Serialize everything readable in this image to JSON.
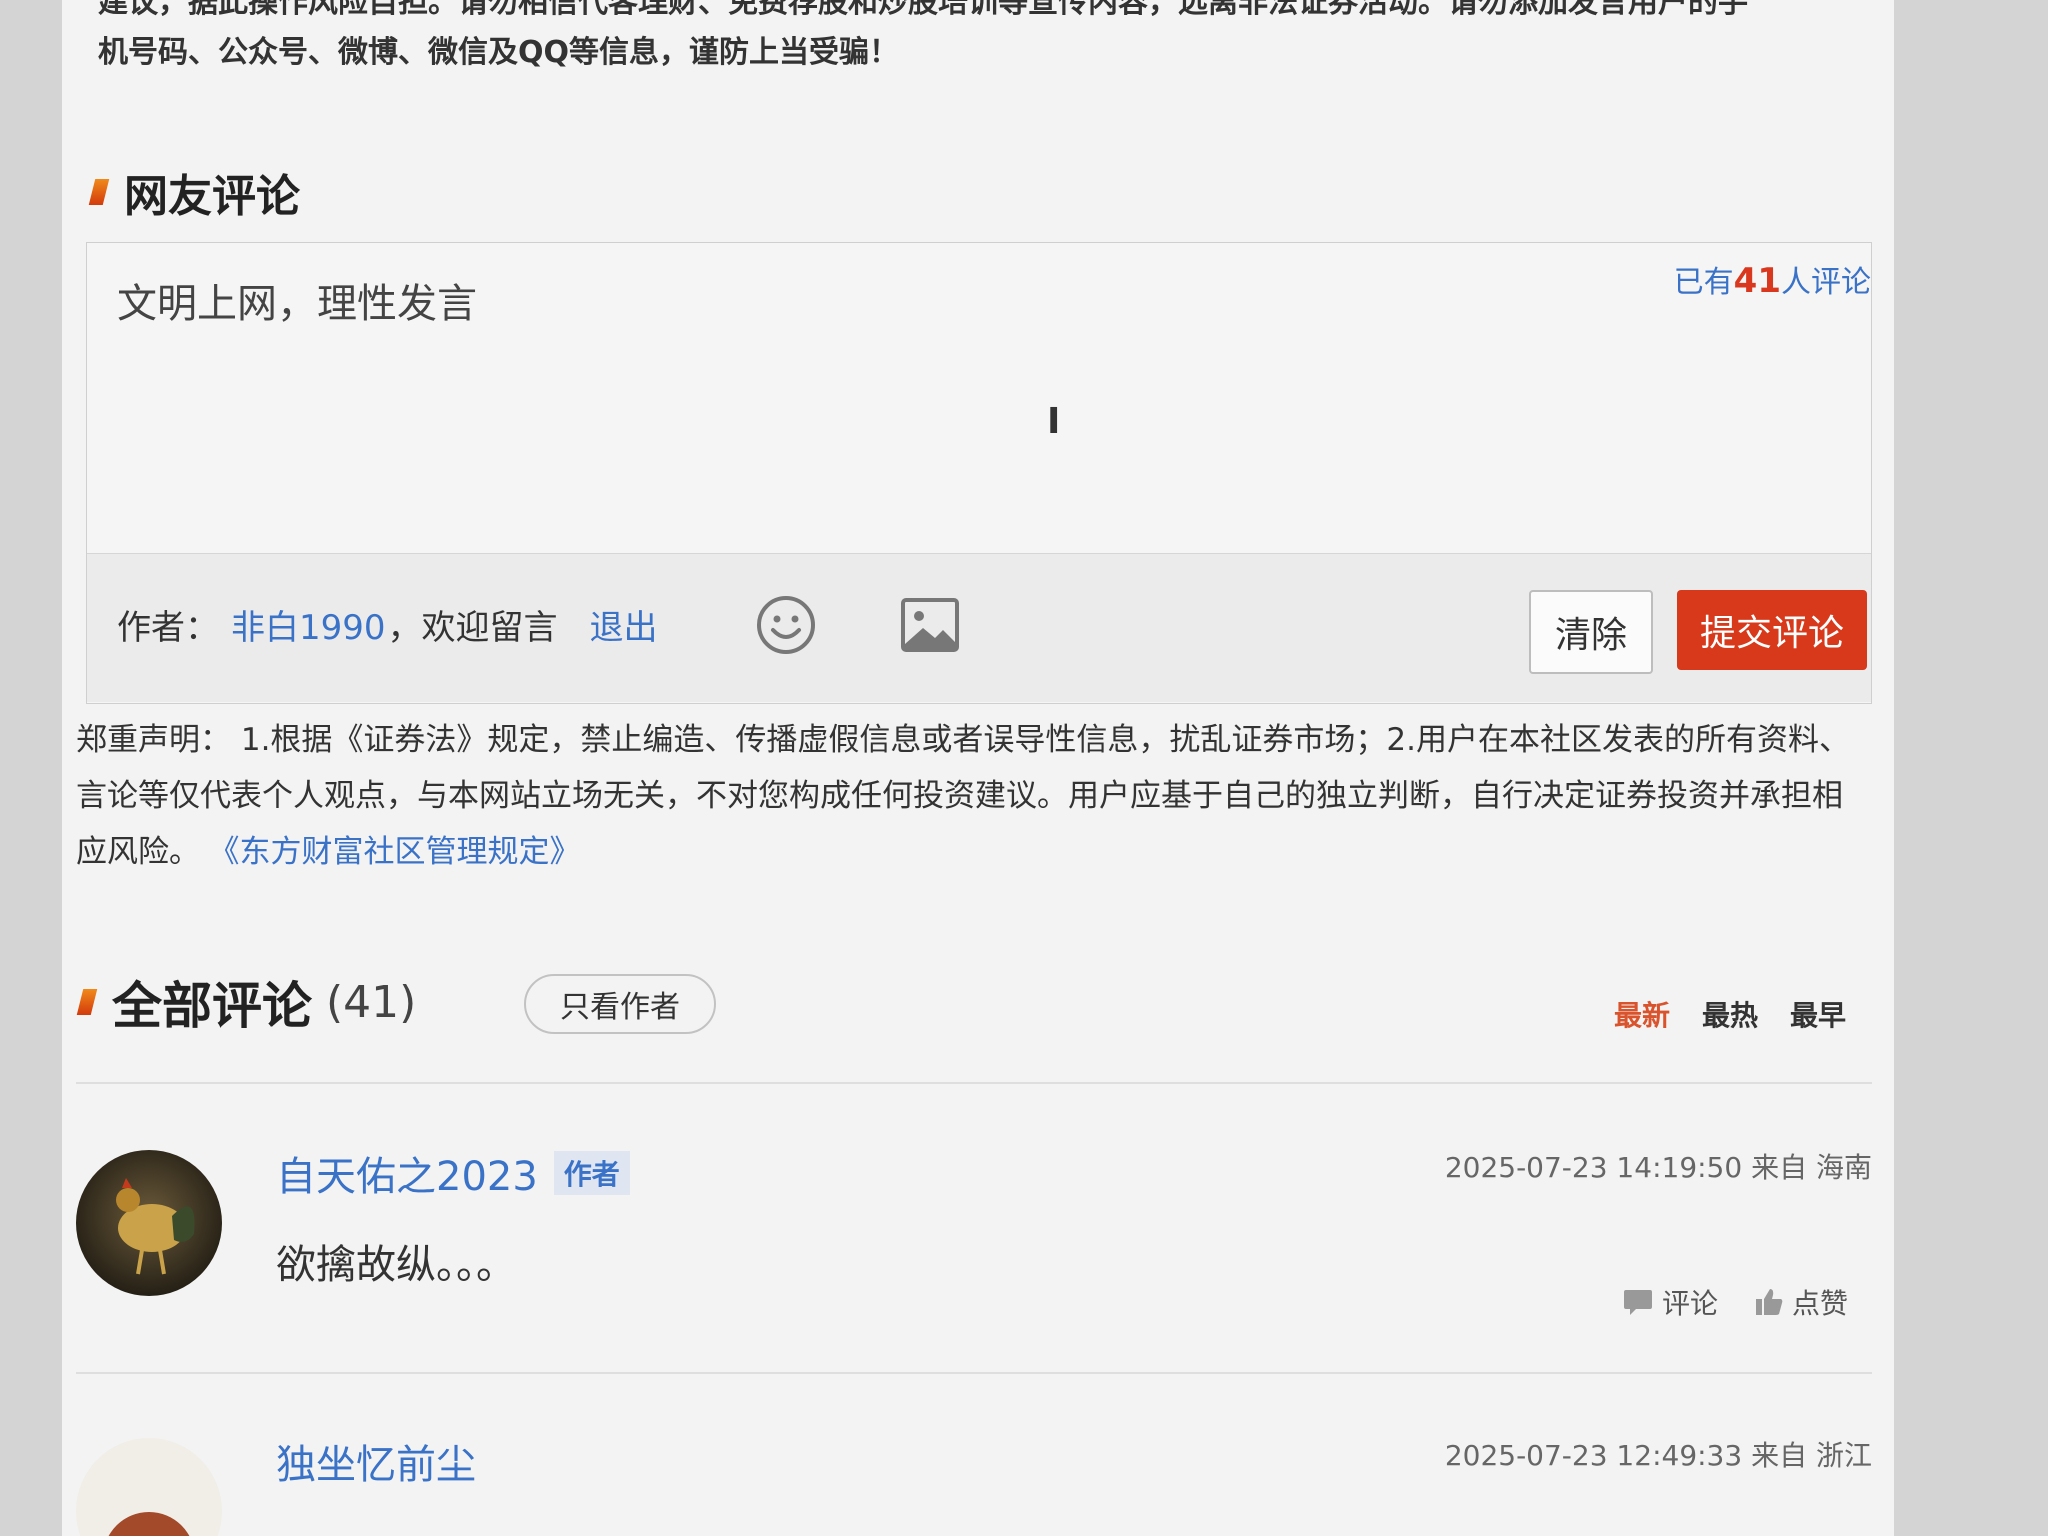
{
  "disclaimer_top": {
    "line1": "建议，据此操作风险自担。请勿相信代客理财、免费荐股和炒股培训等宣传内容，远离非法证券活动。请勿添加发言用户的手",
    "line2": "机号码、公众号、微博、微信及QQ等信息，谨防上当受骗！"
  },
  "comment_section": {
    "title": "网友评论",
    "count_prefix": "已有",
    "count": "41",
    "count_suffix": "人评论",
    "input_placeholder": "文明上网，理性发言",
    "toolbar": {
      "author_label": "作者：",
      "author_name": "非白1990",
      "welcome": "，欢迎留言",
      "logout": "退出",
      "clear_button": "清除",
      "submit_button": "提交评论"
    }
  },
  "statement": {
    "text": "郑重声明： 1.根据《证券法》规定，禁止编造、传播虚假信息或者误导性信息，扰乱证券市场；2.用户在本社区发表的所有资料、言论等仅代表个人观点，与本网站立场无关，不对您构成任何投资建议。用户应基于自己的独立判断，自行决定证券投资并承担相应风险。",
    "link": "《东方财富社区管理规定》"
  },
  "all_comments": {
    "title": "全部评论",
    "count": "(41)",
    "only_author_button": "只看作者",
    "sort_options": [
      "最新",
      "最热",
      "最早"
    ]
  },
  "comments": [
    {
      "username": "自天佑之2023",
      "author_tag": "作者",
      "time": "2025-07-23 14:19:50 来自 海南",
      "content": "欲擒故纵。。。",
      "reply_label": "评论",
      "like_label": "点赞"
    },
    {
      "username": "独坐忆前尘",
      "time": "2025-07-23 12:49:33 来自 浙江"
    }
  ],
  "colors": {
    "link_blue": "#3a72c8",
    "accent_red": "#d8391b",
    "sort_active": "#d9532c"
  },
  "icons": [
    "emoji-icon",
    "image-icon",
    "comment-icon",
    "thumbs-up-icon",
    "title-mark-icon"
  ]
}
